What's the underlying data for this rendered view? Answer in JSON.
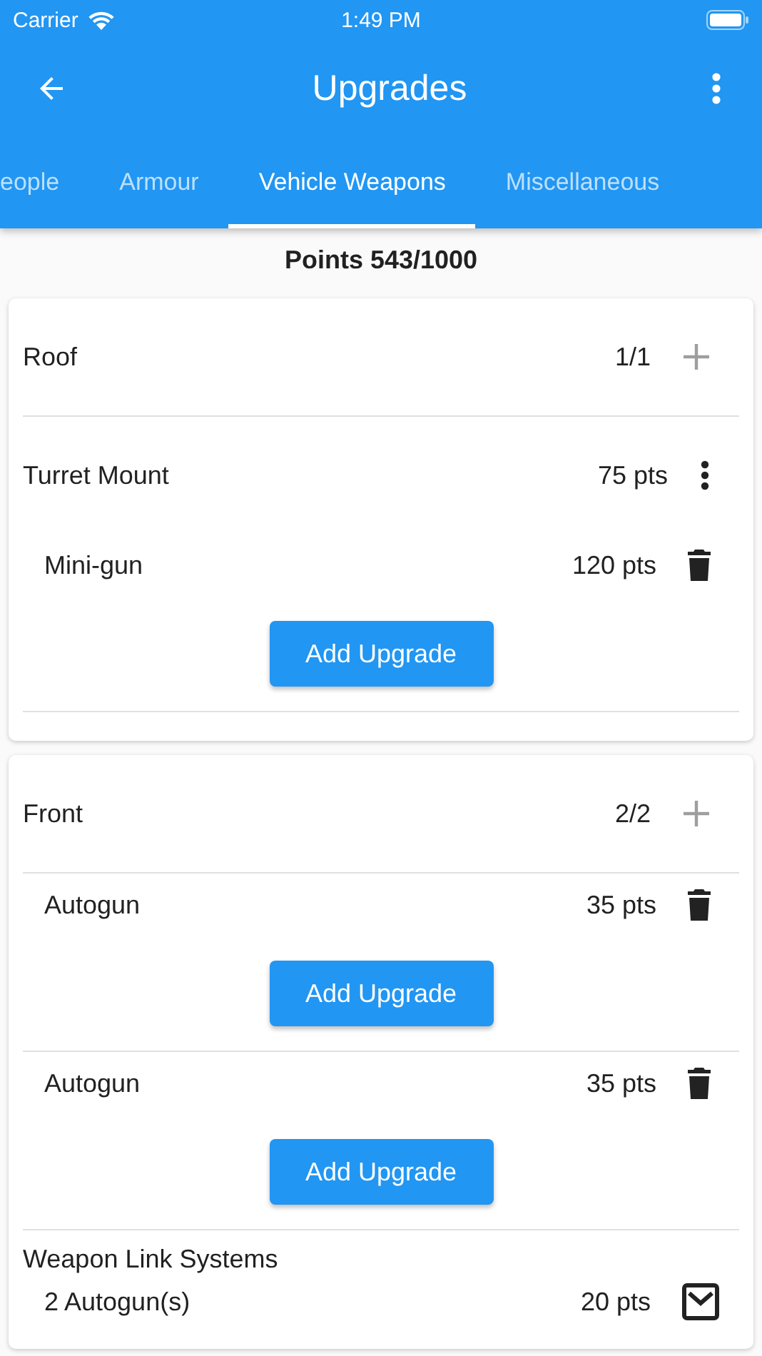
{
  "status_bar": {
    "carrier": "Carrier",
    "time": "1:49 PM"
  },
  "app_bar": {
    "title": "Upgrades"
  },
  "tabs": [
    {
      "label": "eople",
      "selected": false
    },
    {
      "label": "Armour",
      "selected": false
    },
    {
      "label": "Vehicle Weapons",
      "selected": true
    },
    {
      "label": "Miscellaneous",
      "selected": false
    }
  ],
  "points": "Points 543/1000",
  "sections": [
    {
      "title": "Roof",
      "count": "1/1",
      "rows": [
        {
          "kind": "mount",
          "name": "Turret Mount",
          "points": "75 pts"
        },
        {
          "kind": "weapon",
          "name": "Mini-gun",
          "points": "120 pts"
        },
        {
          "kind": "add",
          "label": "Add Upgrade"
        }
      ]
    },
    {
      "title": "Front",
      "count": "2/2",
      "rows": [
        {
          "kind": "weapon",
          "name": "Autogun",
          "points": "35 pts"
        },
        {
          "kind": "add",
          "label": "Add Upgrade"
        },
        {
          "kind": "weapon",
          "name": "Autogun",
          "points": "35 pts"
        },
        {
          "kind": "add",
          "label": "Add Upgrade"
        },
        {
          "kind": "link",
          "name": "Weapon Link Systems",
          "detail": "2 Autogun(s)",
          "points": "20 pts",
          "checked": true
        }
      ]
    }
  ]
}
